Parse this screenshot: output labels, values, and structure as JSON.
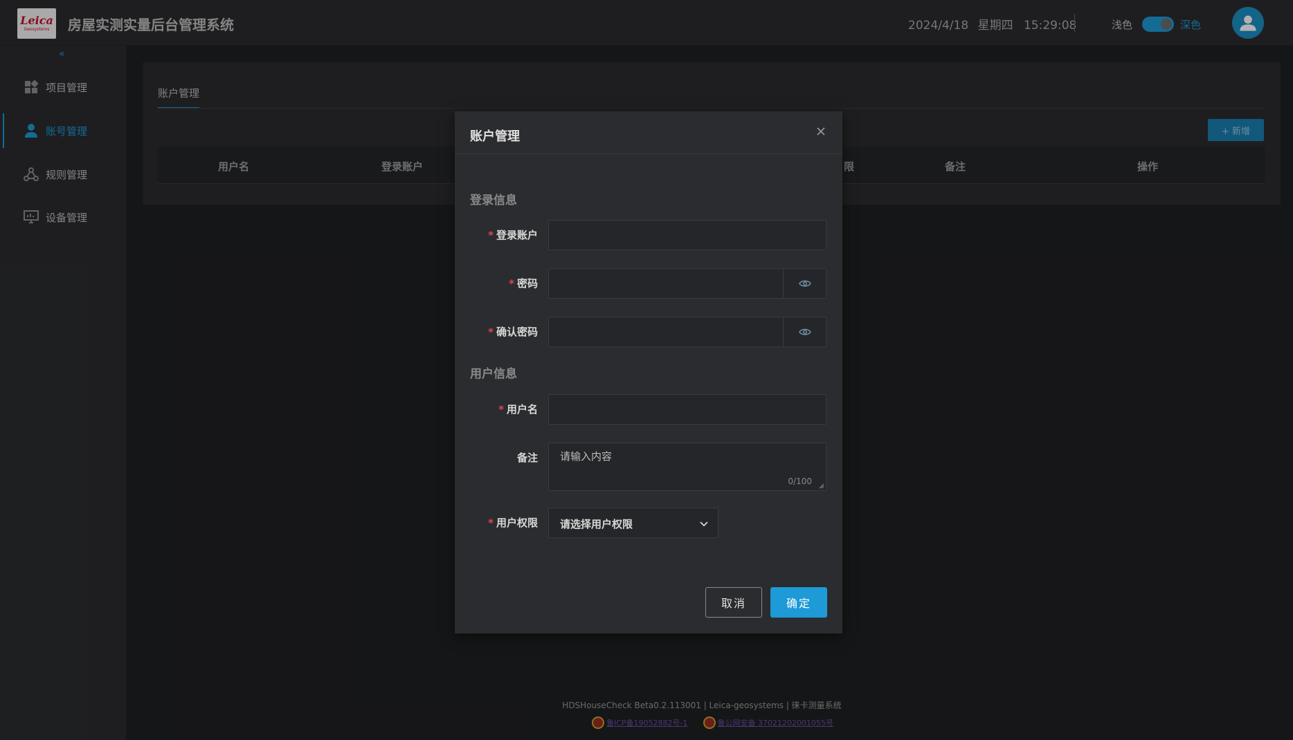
{
  "header": {
    "app_title": "房屋实测实量后台管理系统",
    "logo_word": "Leica",
    "logo_sub": "Geosystems",
    "date": "2024/4/18",
    "weekday": "星期四",
    "time": "15:29:08",
    "theme_light_label": "浅色",
    "theme_dark_label": "深色",
    "theme_toggle_on": true
  },
  "sidebar": {
    "collapse_glyph": "«",
    "items": [
      {
        "label": "项目管理",
        "icon": "grid-icon",
        "active": false
      },
      {
        "label": "账号管理",
        "icon": "user-icon",
        "active": true
      },
      {
        "label": "规则管理",
        "icon": "nodes-icon",
        "active": false
      },
      {
        "label": "设备管理",
        "icon": "monitor-icon",
        "active": false
      }
    ]
  },
  "main": {
    "tab_label": "账户管理",
    "add_button_label": "+ 新增",
    "columns": [
      "用户名",
      "登录账户",
      "限",
      "备注",
      "操作"
    ]
  },
  "dialog": {
    "title": "账户管理",
    "login_section": "登录信息",
    "user_section": "用户信息",
    "fields": {
      "account_label": "登录账户",
      "password_label": "密码",
      "confirm_password_label": "确认密码",
      "username_label": "用户名",
      "remark_label": "备注",
      "remark_placeholder": "请输入内容",
      "remark_count": "0/100",
      "permission_label": "用户权限",
      "permission_placeholder": "请选择用户权限"
    },
    "cancel_label": "取消",
    "ok_label": "确定"
  },
  "footer": {
    "version_line": "HDSHouseCheck Beta0.2.113001 | Leica-geosystems | 徕卡测量系统",
    "icp_link": "鲁ICP备19052882号-1",
    "police_link": "鲁公网安备 37021202001055号"
  },
  "colors": {
    "accent": "#1e9ad6",
    "background": "#1f2022",
    "panel": "#2b2c2f",
    "required": "#e0464b"
  }
}
